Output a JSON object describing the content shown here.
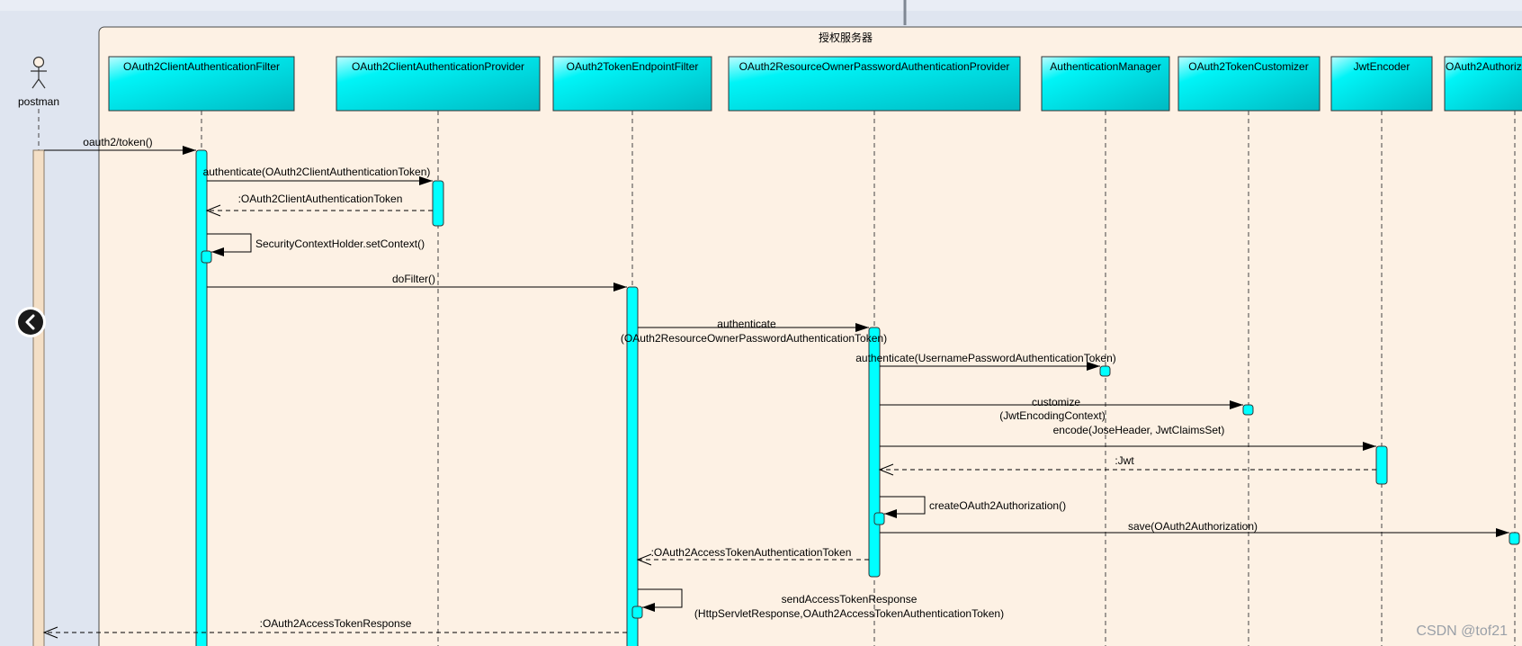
{
  "frame": {
    "title": "授权服务器"
  },
  "actor": {
    "name": "postman"
  },
  "participants": [
    "OAuth2ClientAuthenticationFilter",
    "OAuth2ClientAuthenticationProvider",
    "OAuth2TokenEndpointFilter",
    "OAuth2ResourceOwnerPasswordAuthenticationProvider",
    "AuthenticationManager",
    "OAuth2TokenCustomizer",
    "JwtEncoder",
    "OAuth2Authoriz"
  ],
  "messages": [
    {
      "from": "postman",
      "to": "OAuth2ClientAuthenticationFilter",
      "kind": "sync",
      "text": "oauth2/token()"
    },
    {
      "from": "OAuth2ClientAuthenticationFilter",
      "to": "OAuth2ClientAuthenticationProvider",
      "kind": "sync",
      "text": "authenticate(OAuth2ClientAuthenticationToken)"
    },
    {
      "from": "OAuth2ClientAuthenticationProvider",
      "to": "OAuth2ClientAuthenticationFilter",
      "kind": "return",
      "text": ":OAuth2ClientAuthenticationToken"
    },
    {
      "from": "OAuth2ClientAuthenticationFilter",
      "to": "OAuth2ClientAuthenticationFilter",
      "kind": "self",
      "text": "SecurityContextHolder.setContext()"
    },
    {
      "from": "OAuth2ClientAuthenticationFilter",
      "to": "OAuth2TokenEndpointFilter",
      "kind": "sync",
      "text": "doFilter()"
    },
    {
      "from": "OAuth2TokenEndpointFilter",
      "to": "OAuth2ResourceOwnerPasswordAuthenticationProvider",
      "kind": "sync",
      "text": "authenticate",
      "text2": "(OAuth2ResourceOwnerPasswordAuthenticationToken)"
    },
    {
      "from": "OAuth2ResourceOwnerPasswordAuthenticationProvider",
      "to": "AuthenticationManager",
      "kind": "sync",
      "text": "authenticate(UsernamePasswordAuthenticationToken)"
    },
    {
      "from": "OAuth2ResourceOwnerPasswordAuthenticationProvider",
      "to": "OAuth2TokenCustomizer",
      "kind": "sync",
      "text": "customize",
      "text2": "(JwtEncodingContext)"
    },
    {
      "from": "OAuth2ResourceOwnerPasswordAuthenticationProvider",
      "to": "JwtEncoder",
      "kind": "sync",
      "text": "encode(JoseHeader, JwtClaimsSet)"
    },
    {
      "from": "JwtEncoder",
      "to": "OAuth2ResourceOwnerPasswordAuthenticationProvider",
      "kind": "return",
      "text": ":Jwt"
    },
    {
      "from": "OAuth2ResourceOwnerPasswordAuthenticationProvider",
      "to": "OAuth2ResourceOwnerPasswordAuthenticationProvider",
      "kind": "self",
      "text": "createOAuth2Authorization()"
    },
    {
      "from": "OAuth2ResourceOwnerPasswordAuthenticationProvider",
      "to": "OAuth2Authoriz",
      "kind": "sync",
      "text": "save(OAuth2Authorization)"
    },
    {
      "from": "OAuth2ResourceOwnerPasswordAuthenticationProvider",
      "to": "OAuth2TokenEndpointFilter",
      "kind": "return",
      "text": ":OAuth2AccessTokenAuthenticationToken"
    },
    {
      "from": "OAuth2TokenEndpointFilter",
      "to": "OAuth2TokenEndpointFilter",
      "kind": "self",
      "text": "sendAccessTokenResponse",
      "text2": "(HttpServletResponse,OAuth2AccessTokenAuthenticationToken)"
    },
    {
      "from": "OAuth2TokenEndpointFilter",
      "to": "postman",
      "kind": "return",
      "text": ":OAuth2AccessTokenResponse"
    }
  ],
  "nav": {
    "collapse_icon": "chevron-left-icon"
  },
  "watermark": "CSDN @tof21",
  "colors": {
    "frame_bg": "#fdf1e4",
    "participant": "#00ffff",
    "activation": "#00ffff",
    "actor_bar": "#f4dfc6",
    "outer_bg": "#dfe5f0"
  }
}
